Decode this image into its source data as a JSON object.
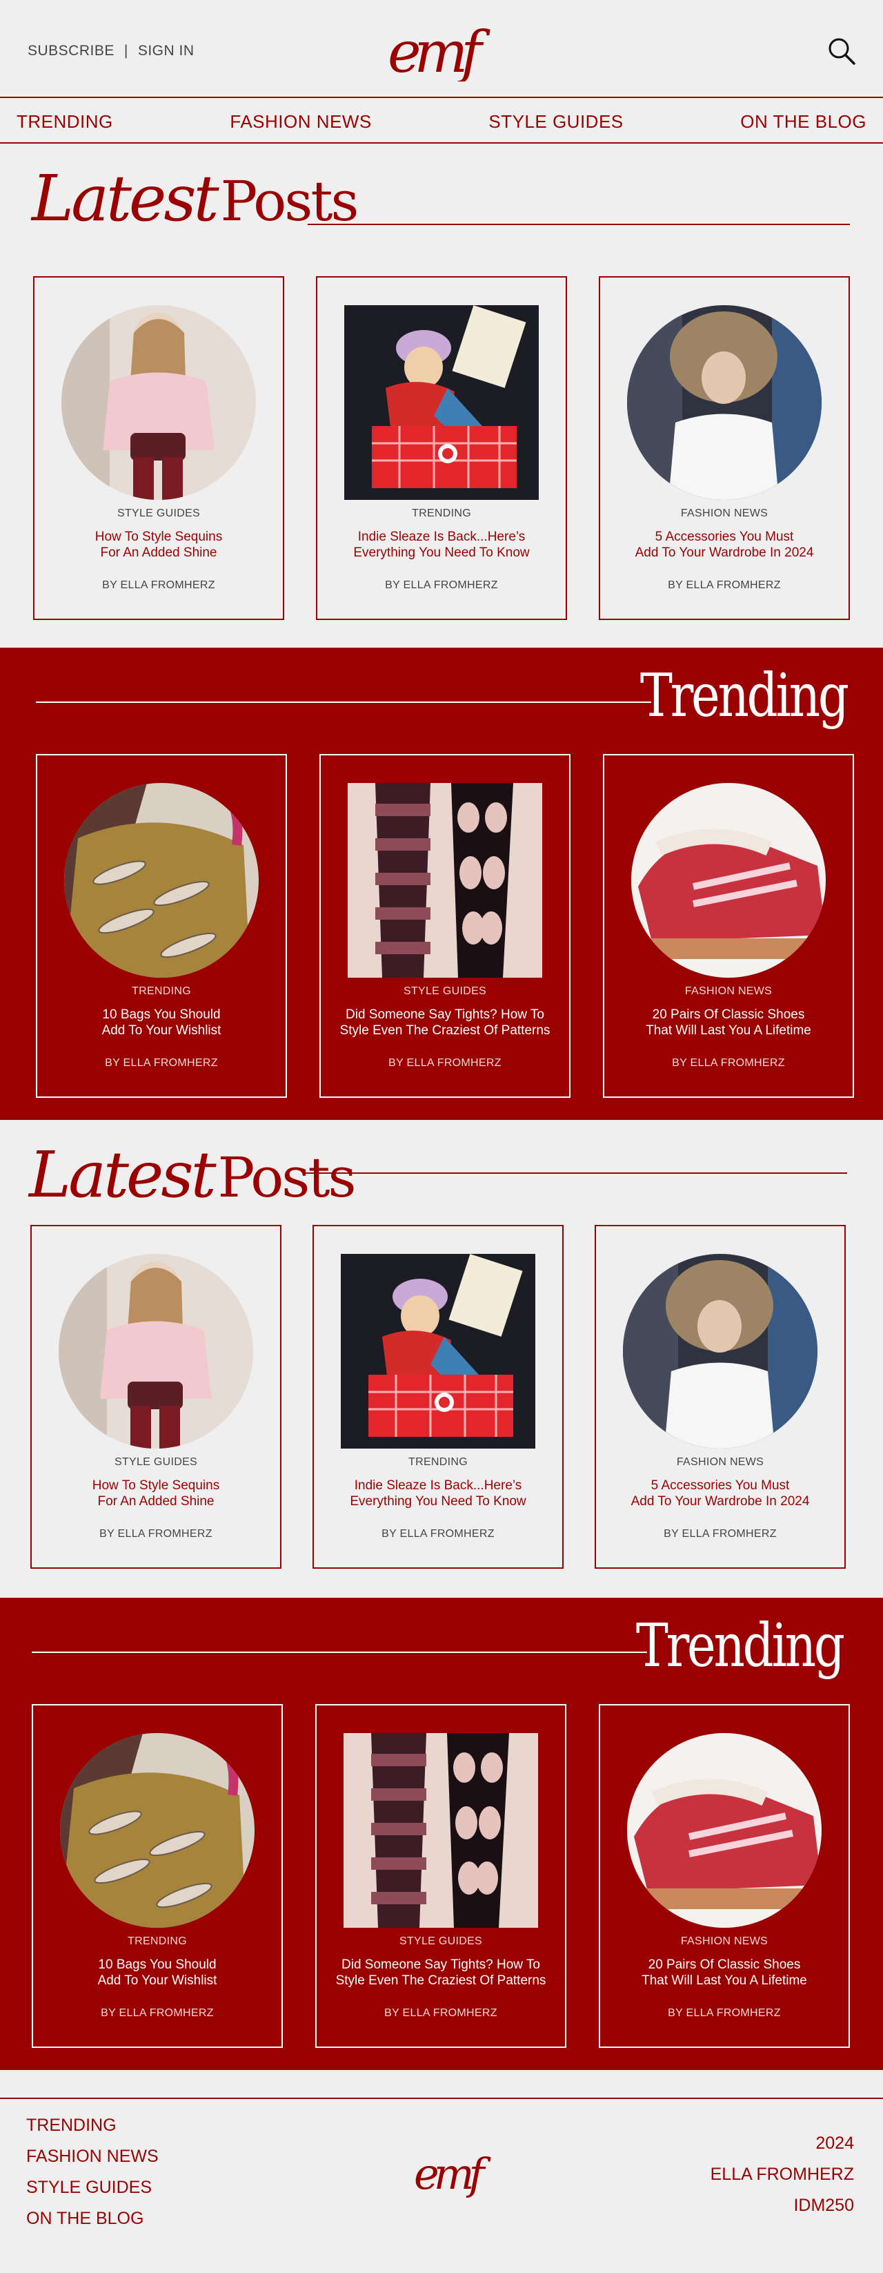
{
  "header": {
    "subscribe": "SUBSCRIBE",
    "separator": "|",
    "signin": "SIGN IN",
    "logo": "emf",
    "search_icon": "search-icon"
  },
  "nav": [
    "TRENDING",
    "FASHION NEWS",
    "STYLE GUIDES",
    "ON THE BLOG"
  ],
  "latest_title": {
    "script": "Latest",
    "plain": "Posts"
  },
  "trending_title": "Trending",
  "latest_posts": [
    {
      "category": "STYLE GUIDES",
      "title_1": "How To Style Sequins",
      "title_2": "For An Added Shine",
      "author": "BY ELLA FROMHERZ",
      "image": "pink-sweater-sequins",
      "shape": "circle"
    },
    {
      "category": "TRENDING",
      "title_1": "Indie Sleaze Is Back...Here’s",
      "title_2": "Everything You Need To Know",
      "author": "BY ELLA FROMHERZ",
      "image": "shopping-cart-model",
      "shape": "square"
    },
    {
      "category": "FASHION NEWS",
      "title_1": "5 Accessories You Must",
      "title_2": "Add To Your Wardrobe In 2024",
      "author": "BY ELLA FROMHERZ",
      "image": "fur-hat-model",
      "shape": "circle"
    }
  ],
  "trending_posts": [
    {
      "category": "TRENDING",
      "title_1": "10 Bags You Should",
      "title_2": "Add To Your Wishlist",
      "author": "BY ELLA FROMHERZ",
      "image": "sequin-bag",
      "shape": "circle"
    },
    {
      "category": "STYLE GUIDES",
      "title_1": "Did Someone Say Tights? How To",
      "title_2": "Style Even The Craziest Of Patterns",
      "author": "BY ELLA FROMHERZ",
      "image": "patterned-tights",
      "shape": "square"
    },
    {
      "category": "FASHION NEWS",
      "title_1": "20 Pairs Of Classic Shoes",
      "title_2": "That Will Last You A Lifetime",
      "author": "BY ELLA FROMHERZ",
      "image": "red-sneakers",
      "shape": "circle"
    }
  ],
  "footer": {
    "links": [
      "TRENDING",
      "FASHION NEWS",
      "STYLE GUIDES",
      "ON THE BLOG"
    ],
    "logo": "emf",
    "info": [
      "2024",
      "ELLA FROMHERZ",
      "IDM250"
    ]
  },
  "colors": {
    "accent": "#9b0000",
    "background": "#efefef",
    "text_gray": "#444444"
  }
}
